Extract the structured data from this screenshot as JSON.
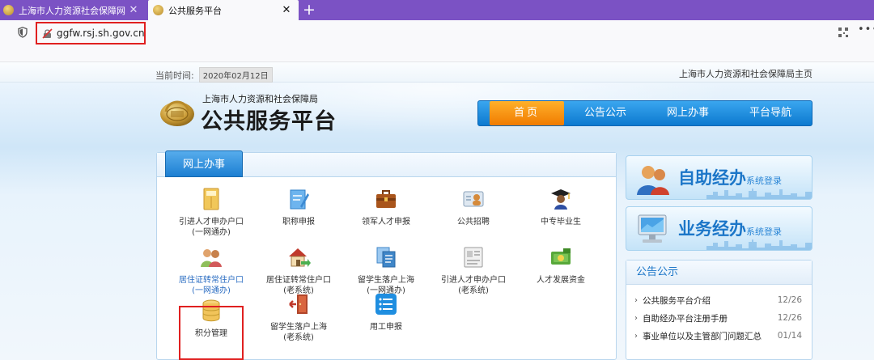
{
  "browser": {
    "tabs": [
      {
        "title": "上海市人力资源社会保障网",
        "active": false
      },
      {
        "title": "公共服务平台",
        "active": true
      }
    ],
    "new_tab": "+",
    "url": "ggfw.rsj.sh.gov.cn",
    "menu_glyph": "•••"
  },
  "header": {
    "date_label": "当前时间:",
    "date_value": "2020年02月12日",
    "home_link": "上海市人力资源和社会保障局主页",
    "logo_sub": "上海市人力资源和社会保障局",
    "logo_main": "公共服务平台",
    "nav": [
      "首页",
      "公告公示",
      "网上办事",
      "平台导航"
    ],
    "nav_active_index": 0
  },
  "panel": {
    "tab_label": "网上办事",
    "services": [
      {
        "line1": "引进人才申办户口",
        "line2": "(一网通办)",
        "icon": "folder-icon",
        "link": false
      },
      {
        "line1": "职称申报",
        "line2": "",
        "icon": "edit-document-icon",
        "link": false
      },
      {
        "line1": "领军人才申报",
        "line2": "",
        "icon": "briefcase-icon",
        "link": false
      },
      {
        "line1": "公共招聘",
        "line2": "",
        "icon": "id-card-icon",
        "link": false
      },
      {
        "line1": "中专毕业生",
        "line2": "",
        "icon": "graduate-icon",
        "link": false
      },
      {
        "line1": "居住证转常住户口",
        "line2": "(一网通办)",
        "icon": "couple-icon",
        "link": true
      },
      {
        "line1": "居住证转常住户口",
        "line2": "(老系统)",
        "icon": "house-arrow-icon",
        "link": false
      },
      {
        "line1": "留学生落户上海",
        "line2": "(一网通办)",
        "icon": "documents-icon",
        "link": false
      },
      {
        "line1": "引进人才申办户口",
        "line2": "(老系统)",
        "icon": "profile-card-icon",
        "link": false
      },
      {
        "line1": "人才发展资金",
        "line2": "",
        "icon": "money-icon",
        "link": false
      },
      {
        "line1": "积分管理",
        "line2": "",
        "icon": "database-icon",
        "link": false
      },
      {
        "line1": "留学生落户上海",
        "line2": "(老系统)",
        "icon": "door-exit-icon",
        "link": false
      },
      {
        "line1": "用工申报",
        "line2": "",
        "icon": "list-document-icon",
        "link": false
      }
    ]
  },
  "sidebar": {
    "self_service": {
      "big": "自助经办",
      "small": "系统登录"
    },
    "business": {
      "big": "业务经办",
      "small": "系统登录"
    },
    "notice": {
      "title": "公告公示",
      "items": [
        {
          "title": "公共服务平台介绍",
          "date": "12/26"
        },
        {
          "title": "自助经办平台注册手册",
          "date": "12/26"
        },
        {
          "title": "事业单位以及主管部门问题汇总",
          "date": "01/14"
        }
      ]
    }
  },
  "colors": {
    "tab_bar": "#7b52c4",
    "nav_blue": "#0c79cf",
    "nav_active": "#f07b00",
    "highlight_red": "#e02020",
    "link_blue": "#2a6cc2"
  }
}
